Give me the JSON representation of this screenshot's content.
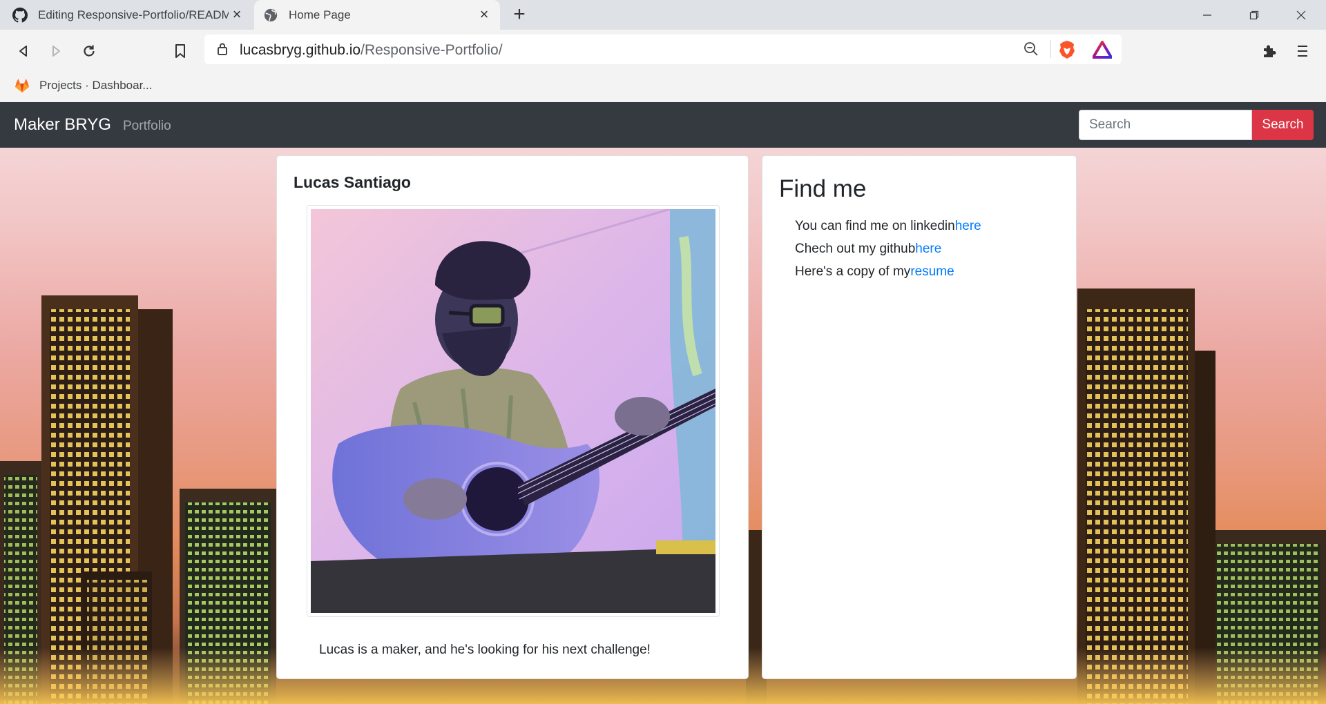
{
  "browser": {
    "tabs": [
      {
        "title": "Editing Responsive-Portfolio/README",
        "active": false
      },
      {
        "title": "Home Page",
        "active": true
      }
    ],
    "url_host": "lucasbryg.github.io",
    "url_path": "/Responsive-Portfolio/",
    "bookmarks": [
      {
        "label": "Projects · Dashboar..."
      }
    ]
  },
  "navbar": {
    "brand": "Maker BRYG",
    "links": [
      "Portfolio"
    ],
    "search_placeholder": "Search",
    "search_button": "Search"
  },
  "profile": {
    "name": "Lucas Santiago",
    "description": "Lucas is a maker, and he's looking for his next challenge!"
  },
  "find_me": {
    "title": "Find me",
    "items": [
      {
        "text": "You can find me on linkedin",
        "link": "here"
      },
      {
        "text": "Chech out my github",
        "link": "here"
      },
      {
        "text": "Here's a copy of my",
        "link": "resume"
      }
    ]
  },
  "colors": {
    "navbar": "#343a40",
    "search_button": "#dc3545",
    "link": "#007bff",
    "brave": "#fb542b"
  },
  "icons": [
    "github-icon",
    "globe-icon",
    "close-icon",
    "plus-icon",
    "back-icon",
    "forward-icon",
    "reload-icon",
    "bookmark-icon",
    "lock-icon",
    "zoom-out-icon",
    "brave-shield-icon",
    "brave-rewards-icon",
    "extensions-icon",
    "menu-icon",
    "gitlab-icon"
  ]
}
